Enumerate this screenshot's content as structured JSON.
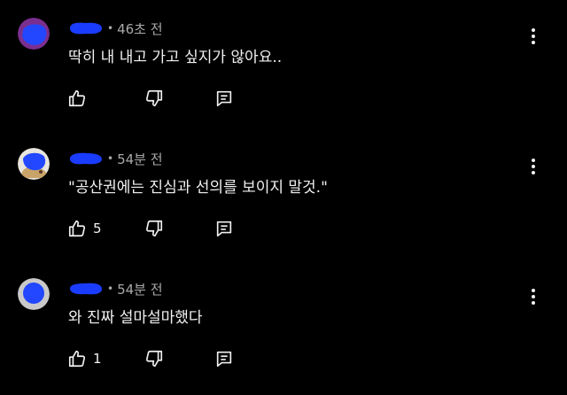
{
  "colors": {
    "background": "#000000",
    "text": "#f1f1f1",
    "secondary": "#aaaaaa",
    "redaction": "#1a3cff"
  },
  "comments": [
    {
      "time": "46초 전",
      "dot": "•",
      "text": "딱히 내 내고 가고 싶지가 않아요..",
      "likes": "",
      "avatar": "avatar-purple-redacted"
    },
    {
      "time": "54분 전",
      "dot": "•",
      "text": "\"공산권에는 진심과 선의를 보이지 말것.\"",
      "likes": "5",
      "avatar": "avatar-cartoon-redacted"
    },
    {
      "time": "54분 전",
      "dot": "•",
      "text": "와 진짜 설마설마했다",
      "likes": "1",
      "avatar": "avatar-grey-redacted"
    }
  ]
}
